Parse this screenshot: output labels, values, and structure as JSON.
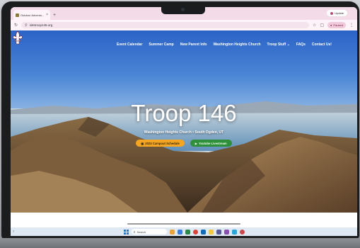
{
  "browser": {
    "tab_title": "Outdoor Adventu...",
    "tab_close": "×",
    "new_tab": "+",
    "profile_label": "Update",
    "url": "sitetroop146.org",
    "paused_label": "Paused"
  },
  "site": {
    "nav": [
      "Event Calendar",
      "Summer Camp",
      "New Parent Info",
      "Washington Heights Church",
      "Troop Stuff ⌄",
      "FAQs",
      "Contact Us!"
    ],
    "title": "Troop 146",
    "subtitle": "Washington Heights Church • South Ogden, UT",
    "cta_schedule": "2023 Campout Schedule",
    "cta_youtube": "Youtube Livestream"
  },
  "taskbar": {
    "search_placeholder": "Search",
    "left_text": "7"
  },
  "colors": {
    "tabbar": "#f3dbe7",
    "sky_top": "#2b63c6",
    "cta_orange": "#f4a623",
    "cta_green": "#2f8f3a",
    "taskbar": "#dfe9f3"
  },
  "icons": [
    "fleur-de-lis-logo",
    "search-icon",
    "windows-start-icon",
    "lock-icon",
    "star-icon",
    "calendar-icon",
    "youtube-icon"
  ]
}
